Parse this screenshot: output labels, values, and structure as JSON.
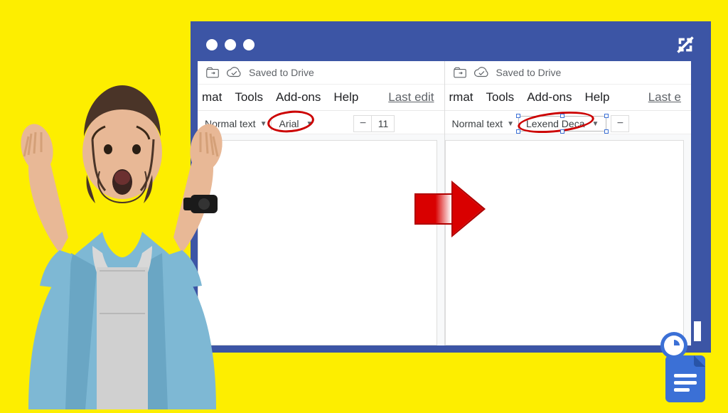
{
  "titlebar": {},
  "left": {
    "saved_label": "Saved to Drive",
    "menu": {
      "format": "mat",
      "tools": "Tools",
      "addons": "Add-ons",
      "help": "Help",
      "last_edit": "Last edit"
    },
    "toolbar": {
      "style": "Normal text",
      "font": "Arial",
      "size": "11",
      "minus": "−"
    }
  },
  "right": {
    "saved_label": "Saved to Drive",
    "menu": {
      "format": "rmat",
      "tools": "Tools",
      "addons": "Add-ons",
      "help": "Help",
      "last_edit": "Last e"
    },
    "toolbar": {
      "style": "Normal text",
      "font": "Lexend Deca",
      "minus": "−"
    }
  }
}
